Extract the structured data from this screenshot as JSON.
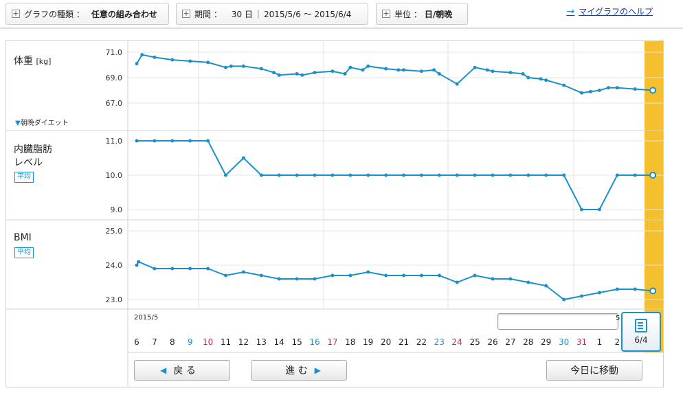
{
  "toolbar": {
    "graph_type_label": "グラフの種類 ：",
    "graph_type_value": "任意の組み合わせ",
    "period_label": "期間 ：",
    "period_days": "30 日",
    "period_range": "2015/5/6 〜 2015/6/4",
    "unit_label": "単位 ：",
    "unit_value": "日/朝晩",
    "help_link": "マイグラフのヘルプ"
  },
  "panels": {
    "weight_label": "体重",
    "weight_unit": "[kg]",
    "weight_mode": "朝晩ダイエット",
    "visceral_label_line1": "内臓脂肪",
    "visceral_label_line2": "レベル",
    "visceral_badge": "平均",
    "bmi_label": "BMI",
    "bmi_badge": "平均"
  },
  "date_axis": {
    "month_label": "2015/5",
    "partial_label": "5"
  },
  "memo": {
    "label": "6/4"
  },
  "buttons": {
    "back": "戻 る",
    "forward": "進 む",
    "today": "今日に移動"
  },
  "colors": {
    "line": "#1b8fc9",
    "highlight": "#f5c030",
    "weekday": "#222222",
    "saturday": "#1b8fc9",
    "sunday": "#c8264e"
  },
  "chart_data": [
    {
      "type": "line",
      "ylabel": "体重 [kg]",
      "yticks": [
        "71.0",
        "69.0",
        "67.0"
      ],
      "ylim": [
        66.2,
        71.6
      ],
      "x": [
        6,
        6.3,
        7,
        8,
        9,
        10,
        11,
        11.3,
        12,
        13,
        13.7,
        14,
        15,
        15.3,
        16,
        17,
        17.7,
        18,
        18.7,
        19,
        20,
        20.7,
        21,
        22,
        22.7,
        23,
        24,
        25,
        25.7,
        26,
        27,
        27.7,
        28,
        28.7,
        29,
        30,
        31,
        31.5,
        32,
        32.5,
        33,
        34,
        35
      ],
      "values": [
        70.1,
        70.8,
        70.6,
        70.4,
        70.3,
        70.2,
        69.8,
        69.9,
        69.9,
        69.7,
        69.4,
        69.2,
        69.3,
        69.2,
        69.4,
        69.5,
        69.3,
        69.8,
        69.6,
        69.9,
        69.7,
        69.6,
        69.6,
        69.5,
        69.6,
        69.3,
        68.5,
        69.8,
        69.6,
        69.5,
        69.4,
        69.3,
        69.0,
        68.9,
        68.8,
        68.4,
        67.8,
        67.9,
        68.0,
        68.2,
        68.2,
        68.1,
        68.0
      ],
      "current": 67.9
    },
    {
      "type": "line",
      "ylabel": "内臓脂肪レベル",
      "yticks": [
        "11.0",
        "10.0",
        "9.0"
      ],
      "ylim": [
        8.8,
        11.2
      ],
      "x": [
        6,
        7,
        8,
        9,
        10,
        11,
        12,
        13,
        14,
        15,
        16,
        17,
        18,
        19,
        20,
        21,
        22,
        23,
        24,
        25,
        26,
        27,
        28,
        29,
        30,
        31,
        32,
        33,
        34,
        35
      ],
      "values": [
        11,
        11,
        11,
        11,
        11,
        10,
        10.5,
        10,
        10,
        10,
        10,
        10,
        10,
        10,
        10,
        10,
        10,
        10,
        10,
        10,
        10,
        10,
        10,
        10,
        10,
        9,
        9,
        10,
        10,
        10
      ]
    },
    {
      "type": "line",
      "ylabel": "BMI",
      "yticks": [
        "25.0",
        "24.0",
        "23.0"
      ],
      "ylim": [
        22.8,
        25.2
      ],
      "x": [
        6,
        6.1,
        7,
        8,
        9,
        10,
        11,
        12,
        13,
        14,
        15,
        16,
        17,
        18,
        19,
        20,
        21,
        22,
        23,
        24,
        25,
        26,
        27,
        28,
        29,
        30,
        31,
        32,
        33,
        34,
        35
      ],
      "values": [
        24.0,
        24.1,
        23.9,
        23.9,
        23.9,
        23.9,
        23.7,
        23.8,
        23.7,
        23.6,
        23.6,
        23.6,
        23.7,
        23.7,
        23.8,
        23.7,
        23.7,
        23.7,
        23.7,
        23.5,
        23.7,
        23.6,
        23.6,
        23.5,
        23.4,
        23.0,
        23.1,
        23.2,
        23.3,
        23.3,
        23.25
      ]
    }
  ],
  "days": [
    {
      "d": "6",
      "t": "weekday"
    },
    {
      "d": "7",
      "t": "weekday"
    },
    {
      "d": "8",
      "t": "weekday"
    },
    {
      "d": "9",
      "t": "saturday"
    },
    {
      "d": "10",
      "t": "sunday"
    },
    {
      "d": "11",
      "t": "weekday"
    },
    {
      "d": "12",
      "t": "weekday"
    },
    {
      "d": "13",
      "t": "weekday"
    },
    {
      "d": "14",
      "t": "weekday"
    },
    {
      "d": "15",
      "t": "weekday"
    },
    {
      "d": "16",
      "t": "saturday"
    },
    {
      "d": "17",
      "t": "sunday"
    },
    {
      "d": "18",
      "t": "weekday"
    },
    {
      "d": "19",
      "t": "weekday"
    },
    {
      "d": "20",
      "t": "weekday"
    },
    {
      "d": "21",
      "t": "weekday"
    },
    {
      "d": "22",
      "t": "weekday"
    },
    {
      "d": "23",
      "t": "saturday"
    },
    {
      "d": "24",
      "t": "sunday"
    },
    {
      "d": "25",
      "t": "weekday"
    },
    {
      "d": "26",
      "t": "weekday"
    },
    {
      "d": "27",
      "t": "weekday"
    },
    {
      "d": "28",
      "t": "weekday"
    },
    {
      "d": "29",
      "t": "weekday"
    },
    {
      "d": "30",
      "t": "saturday"
    },
    {
      "d": "31",
      "t": "sunday"
    },
    {
      "d": "1",
      "t": "weekday"
    },
    {
      "d": "2",
      "t": "weekday"
    }
  ]
}
